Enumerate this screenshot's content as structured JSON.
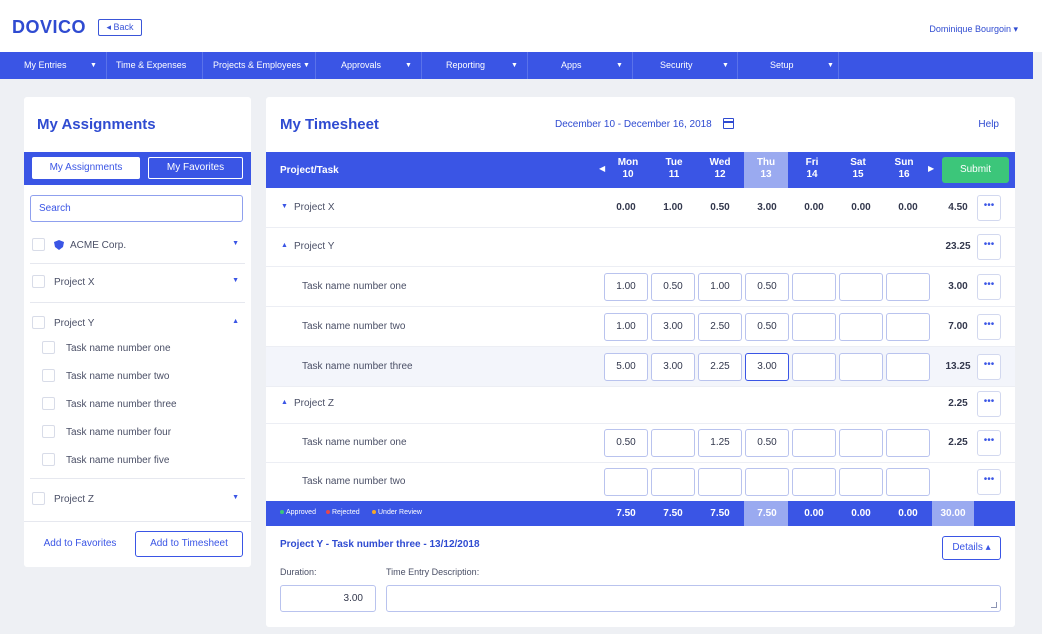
{
  "header": {
    "logo": "DOVICO",
    "back_label": "◂ Back",
    "user_name": "Dominique Bourgoin ▾"
  },
  "nav": {
    "items": [
      {
        "label": "My Entries"
      },
      {
        "label": "Time & Expenses"
      },
      {
        "label": "Projects & Employees"
      },
      {
        "label": "Approvals"
      },
      {
        "label": "Reporting"
      },
      {
        "label": "Apps"
      },
      {
        "label": "Security"
      },
      {
        "label": "Setup"
      }
    ]
  },
  "assignments": {
    "title": "My Assignments",
    "tab_assignments": "My Assignments",
    "tab_favorites": "My Favorites",
    "search_placeholder": "Search",
    "client": "ACME Corp.",
    "project_x": "Project X",
    "project_y": "Project Y",
    "tasks": [
      "Task name number one",
      "Task name number two",
      "Task name number three",
      "Task name number four",
      "Task name number five"
    ],
    "project_z": "Project Z",
    "add_favorites": "Add to Favorites",
    "add_timesheet": "Add to Timesheet"
  },
  "timesheet": {
    "title": "My Timesheet",
    "date_range": "December 10 - December 16, 2018",
    "help": "Help",
    "col_project_task": "Project/Task",
    "days": [
      {
        "name": "Mon",
        "num": "10"
      },
      {
        "name": "Tue",
        "num": "11"
      },
      {
        "name": "Wed",
        "num": "12"
      },
      {
        "name": "Thu",
        "num": "13"
      },
      {
        "name": "Fri",
        "num": "14"
      },
      {
        "name": "Sat",
        "num": "15"
      },
      {
        "name": "Sun",
        "num": "16"
      }
    ],
    "submit": "Submit",
    "more": "•••",
    "rows": {
      "px": {
        "label": "Project X",
        "values": [
          "0.00",
          "1.00",
          "0.50",
          "3.00",
          "0.00",
          "0.00",
          "0.00"
        ],
        "total": "4.50"
      },
      "py": {
        "label": "Project Y",
        "total": "23.25"
      },
      "py_t1": {
        "label": "Task name number one",
        "values": [
          "1.00",
          "0.50",
          "1.00",
          "0.50",
          "",
          "",
          ""
        ],
        "total": "3.00"
      },
      "py_t2": {
        "label": "Task name number two",
        "values": [
          "1.00",
          "3.00",
          "2.50",
          "0.50",
          "",
          "",
          ""
        ],
        "total": "7.00"
      },
      "py_t3": {
        "label": "Task name number three",
        "values": [
          "5.00",
          "3.00",
          "2.25",
          "3.00",
          "",
          "",
          ""
        ],
        "total": "13.25"
      },
      "pz": {
        "label": "Project Z",
        "total": "2.25"
      },
      "pz_t1": {
        "label": "Task name number one",
        "values": [
          "0.50",
          "",
          "1.25",
          "0.50",
          "",
          "",
          ""
        ],
        "total": "2.25"
      },
      "pz_t2": {
        "label": "Task name number two",
        "values": [
          "",
          "",
          "",
          "",
          "",
          "",
          ""
        ],
        "total": ""
      }
    },
    "legend": {
      "approved": "Approved",
      "rejected": "Rejected",
      "under_review": "Under Review"
    },
    "legend_colors": {
      "approved": "#3cc67a",
      "rejected": "#e5484d",
      "under_review": "#f4a62a"
    },
    "day_totals": [
      "7.50",
      "7.50",
      "7.50",
      "7.50",
      "0.00",
      "0.00",
      "0.00"
    ],
    "grand_total": "30.00",
    "entry_title": "Project Y - Task number three - 13/12/2018",
    "details": "Details ▴",
    "duration_label": "Duration:",
    "description_label": "Time Entry Description:",
    "duration_value": "3.00"
  }
}
